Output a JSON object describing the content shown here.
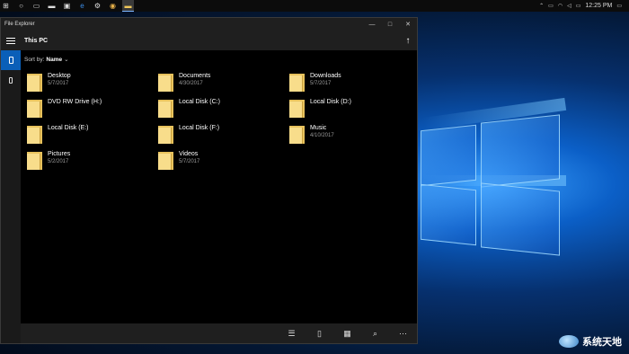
{
  "taskbar": {
    "icons": [
      "start-icon",
      "search-icon",
      "task-view-icon",
      "folder-icon",
      "store-icon",
      "edge-icon",
      "settings-icon",
      "chrome-icon",
      "file-explorer-icon"
    ],
    "time": "12:25 PM"
  },
  "window": {
    "title": "File Explorer",
    "location": "This PC",
    "sort_label": "Sort by:",
    "sort_value": "Name",
    "items": [
      {
        "name": "Desktop",
        "date": "5/7/2017"
      },
      {
        "name": "Documents",
        "date": "4/30/2017"
      },
      {
        "name": "Downloads",
        "date": "5/7/2017"
      },
      {
        "name": "DVD RW Drive (H:)",
        "date": ""
      },
      {
        "name": "Local Disk (C:)",
        "date": ""
      },
      {
        "name": "Local Disk (D:)",
        "date": ""
      },
      {
        "name": "Local Disk (E:)",
        "date": ""
      },
      {
        "name": "Local Disk (F:)",
        "date": ""
      },
      {
        "name": "Music",
        "date": "4/10/2017"
      },
      {
        "name": "Pictures",
        "date": "5/2/2017"
      },
      {
        "name": "Videos",
        "date": "5/7/2017"
      }
    ]
  },
  "watermark": {
    "text": "系统天地"
  }
}
